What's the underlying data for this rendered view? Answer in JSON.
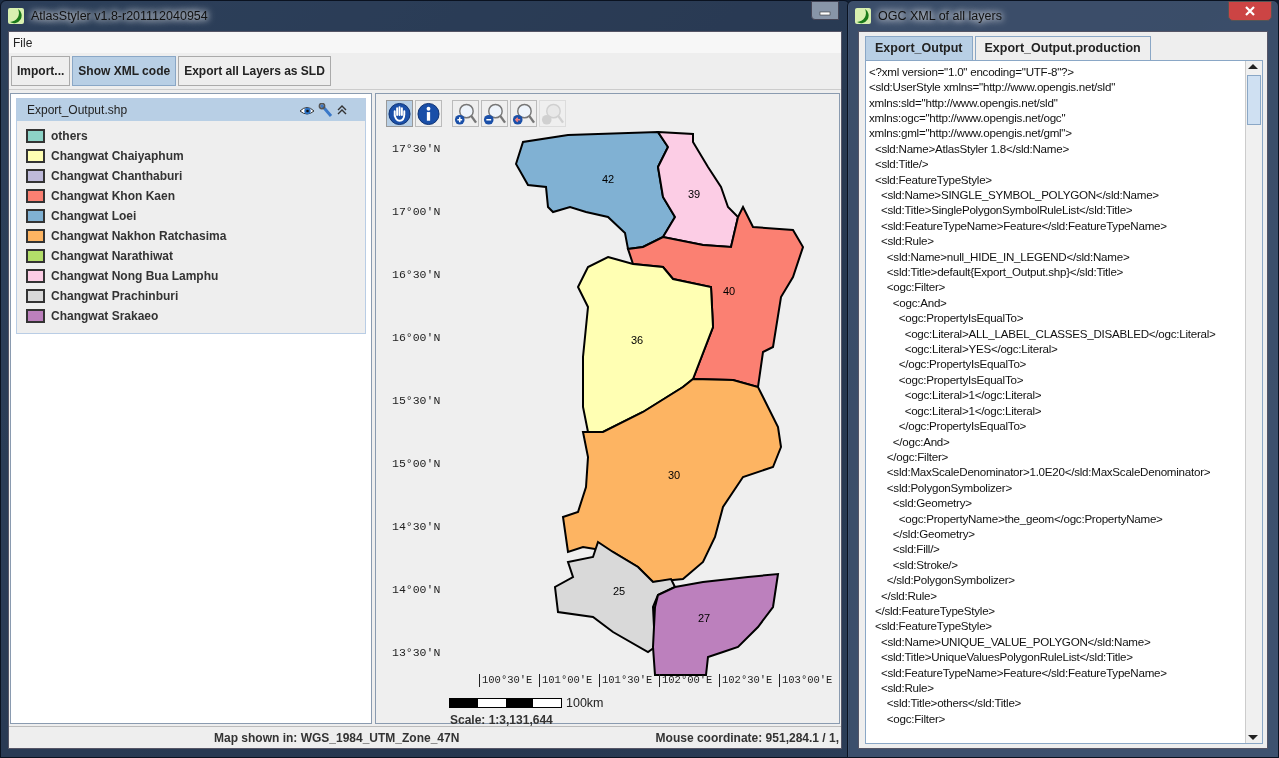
{
  "main_window": {
    "title": "AtlasStyler v1.8-r201112040954",
    "menu": [
      "File"
    ],
    "toolbar": [
      {
        "label": "Import...",
        "selected": false
      },
      {
        "label": "Show XML code",
        "selected": true
      },
      {
        "label": "Export all Layers as SLD",
        "selected": false
      }
    ],
    "layer": {
      "name": "Export_Output.shp",
      "legend": [
        {
          "label": "others",
          "color": "#8dd3c7"
        },
        {
          "label": "Changwat Chaiyaphum",
          "color": "#ffffb3"
        },
        {
          "label": "Changwat Chanthaburi",
          "color": "#bebada"
        },
        {
          "label": "Changwat Khon Kaen",
          "color": "#fb8072"
        },
        {
          "label": "Changwat Loei",
          "color": "#80b1d3"
        },
        {
          "label": "Changwat Nakhon Ratchasima",
          "color": "#fdb462"
        },
        {
          "label": "Changwat Narathiwat",
          "color": "#b3de69"
        },
        {
          "label": "Changwat Nong Bua Lamphu",
          "color": "#fccde5"
        },
        {
          "label": "Changwat Prachinburi",
          "color": "#d9d9d9"
        },
        {
          "label": "Changwat Srakaeo",
          "color": "#bc80bd"
        }
      ]
    },
    "map": {
      "tools": [
        {
          "kind": "pan",
          "selected": true,
          "disabled": false
        },
        {
          "kind": "info",
          "selected": false,
          "disabled": false
        },
        {
          "kind": "zoom-in",
          "selected": false,
          "disabled": false
        },
        {
          "kind": "zoom-out",
          "selected": false,
          "disabled": false
        },
        {
          "kind": "zoom-back",
          "selected": false,
          "disabled": false
        },
        {
          "kind": "zoom-forward",
          "selected": false,
          "disabled": true
        }
      ],
      "regions": [
        {
          "label": "42",
          "color": "#80b1d3"
        },
        {
          "label": "39",
          "color": "#fccde5"
        },
        {
          "label": "40",
          "color": "#fb8072"
        },
        {
          "label": "36",
          "color": "#ffffb3"
        },
        {
          "label": "30",
          "color": "#fdb462"
        },
        {
          "label": "25",
          "color": "#d9d9d9"
        },
        {
          "label": "27",
          "color": "#bc80bd"
        }
      ],
      "lat_labels": [
        "17°30'N",
        "17°00'N",
        "16°30'N",
        "16°00'N",
        "15°30'N",
        "15°00'N",
        "14°30'N",
        "14°00'N",
        "13°30'N"
      ],
      "lon_labels": [
        "100°30'E",
        "101°00'E",
        "101°30'E",
        "102°00'E",
        "102°30'E",
        "103°00'E"
      ],
      "scale_distance": "100km",
      "scale": "Scale: 1:3,131,644"
    },
    "status_bar": {
      "projection": "Map shown in: WGS_1984_UTM_Zone_47N",
      "mouse": "Mouse coordinate:  951,284.1 / 1,"
    }
  },
  "xml_window": {
    "title": "OGC XML of all layers",
    "tabs": [
      {
        "label": "Export_Output",
        "selected": true
      },
      {
        "label": "Export_Output.production",
        "selected": false
      }
    ],
    "lines": [
      "<?xml version=\"1.0\" encoding=\"UTF-8\"?>",
      "<sld:UserStyle xmlns=\"http://www.opengis.net/sld\"",
      "xmlns:sld=\"http://www.opengis.net/sld\"",
      "xmlns:ogc=\"http://www.opengis.net/ogc\"",
      "xmlns:gml=\"http://www.opengis.net/gml\">",
      "  <sld:Name>AtlasStyler 1.8</sld:Name>",
      "  <sld:Title/>",
      "  <sld:FeatureTypeStyle>",
      "    <sld:Name>SINGLE_SYMBOL_POLYGON</sld:Name>",
      "    <sld:Title>SinglePolygonSymbolRuleList</sld:Title>",
      "    <sld:FeatureTypeName>Feature</sld:FeatureTypeName>",
      "    <sld:Rule>",
      "      <sld:Name>null_HIDE_IN_LEGEND</sld:Name>",
      "      <sld:Title>default{Export_Output.shp}</sld:Title>",
      "      <ogc:Filter>",
      "        <ogc:And>",
      "          <ogc:PropertyIsEqualTo>",
      "            <ogc:Literal>ALL_LABEL_CLASSES_DISABLED</ogc:Literal>",
      "            <ogc:Literal>YES</ogc:Literal>",
      "          </ogc:PropertyIsEqualTo>",
      "          <ogc:PropertyIsEqualTo>",
      "            <ogc:Literal>1</ogc:Literal>",
      "            <ogc:Literal>1</ogc:Literal>",
      "          </ogc:PropertyIsEqualTo>",
      "        </ogc:And>",
      "      </ogc:Filter>",
      "      <sld:MaxScaleDenominator>1.0E20</sld:MaxScaleDenominator>",
      "      <sld:PolygonSymbolizer>",
      "        <sld:Geometry>",
      "          <ogc:PropertyName>the_geom</ogc:PropertyName>",
      "        </sld:Geometry>",
      "        <sld:Fill/>",
      "        <sld:Stroke/>",
      "      </sld:PolygonSymbolizer>",
      "    </sld:Rule>",
      "  </sld:FeatureTypeStyle>",
      "  <sld:FeatureTypeStyle>",
      "    <sld:Name>UNIQUE_VALUE_POLYGON</sld:Name>",
      "    <sld:Title>UniqueValuesPolygonRuleList</sld:Title>",
      "    <sld:FeatureTypeName>Feature</sld:FeatureTypeName>",
      "    <sld:Rule>",
      "      <sld:Title>others</sld:Title>",
      "      <ogc:Filter>"
    ]
  }
}
